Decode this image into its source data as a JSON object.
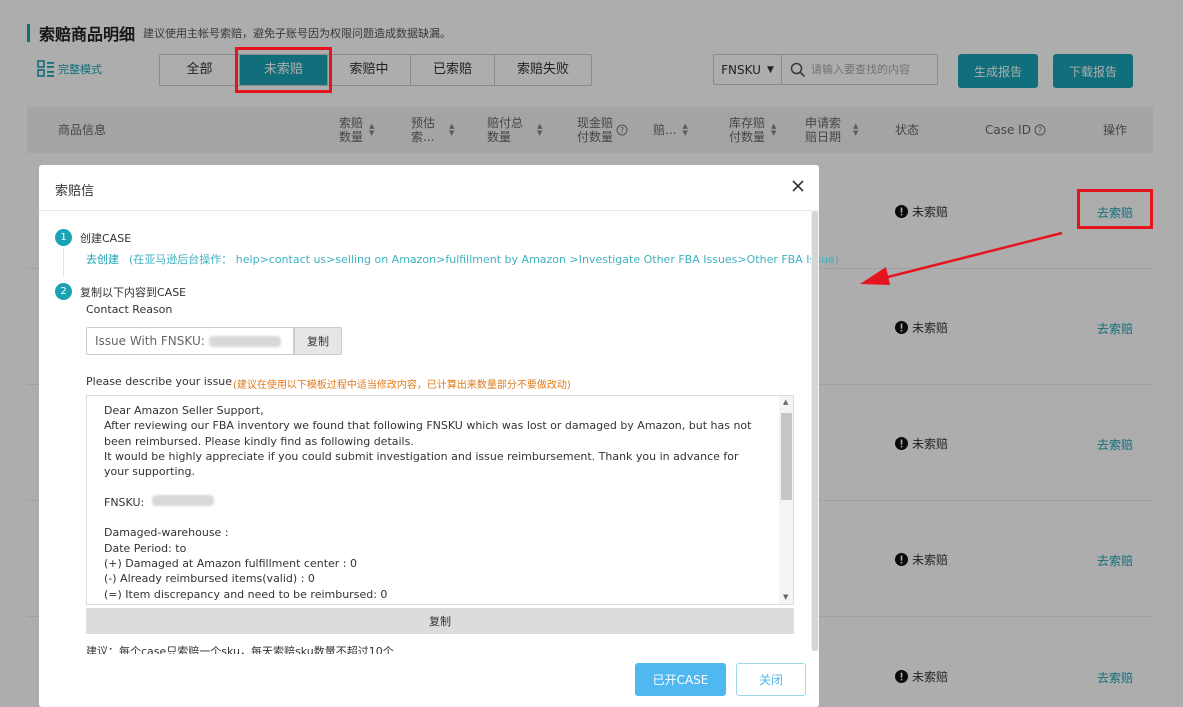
{
  "header": {
    "title": "索赔商品明细",
    "note": "建议使用主帐号索赔，避免子账号因为权限问题造成数据缺漏。",
    "full_mode": "完整模式"
  },
  "tabs": [
    {
      "label": "全部",
      "active": false
    },
    {
      "label": "未索赔",
      "active": true
    },
    {
      "label": "索赔中",
      "active": false
    },
    {
      "label": "已索赔",
      "active": false
    },
    {
      "label": "索赔失败",
      "active": false
    }
  ],
  "search": {
    "field": "FNSKU",
    "placeholder": "请输入要查找的内容"
  },
  "buttons": {
    "generate": "生成报告",
    "download": "下载报告"
  },
  "table": {
    "columns": {
      "product": "商品信息",
      "claim_qty_1": "索赔",
      "claim_qty_2": "数量",
      "est_1": "预估",
      "est_2": "索...",
      "paid_1": "赔付总",
      "paid_2": "数量",
      "cash_1": "现金赔",
      "cash_2": "付数量",
      "pay": "赔...",
      "stock_1": "库存赔",
      "stock_2": "付数量",
      "date_1": "申请索",
      "date_2": "赔日期",
      "status": "状态",
      "case_id": "Case ID",
      "action": "操作"
    },
    "rows": [
      {
        "status": "未索赔",
        "action": "去索赔"
      },
      {
        "status": "未索赔",
        "action": "去索赔"
      },
      {
        "status": "未索赔",
        "action": "去索赔"
      },
      {
        "status": "未索赔",
        "action": "去索赔"
      },
      {
        "status": "未索赔",
        "action": "去索赔"
      }
    ]
  },
  "modal": {
    "title": "索赔信",
    "step1": {
      "num": "1",
      "label": "创建CASE"
    },
    "create_link": "去创建",
    "create_note": "(在亚马逊后台操作： help>contact us>selling on Amazon>fulfillment by Amazon >Investigate Other FBA Issues>Other FBA Issue)",
    "step2": {
      "num": "2",
      "label": "复制以下内容到CASE"
    },
    "contact_reason": "Contact Reason",
    "issue_label": "Issue With FNSKU:",
    "copy_small": "复制",
    "describe_label": "Please describe your issue",
    "describe_note": "(建议在使用以下模板过程中适当修改内容，已计算出来数量部分不要做改动)",
    "letter": {
      "greeting": "Dear Amazon Seller Support,",
      "body1": "After reviewing our FBA inventory we found that following FNSKU which was lost or damaged by Amazon, but has not been reimbursed. Please kindly find as following details.",
      "body2": "It would be highly appreciate if you could submit investigation and issue reimbursement. Thank you in advance for your supporting.",
      "fnsku_label": "FNSKU:",
      "damaged_title": "Damaged-warehouse :",
      "date_period": "Date Period: to",
      "line_damaged": "(+) Damaged at Amazon fulfillment center : 0",
      "line_reimbursed": "(-) Already reimbursed items(valid) : 0",
      "line_discrepancy": "(=) Item discrepancy and need to be reimbursed: 0"
    },
    "copy_big": "复制",
    "advice": "建议：每个case只索赔一个sku，每天索赔sku数量不超过10个",
    "btn_opened": "已开CASE",
    "btn_close": "关闭"
  },
  "colors": {
    "accent": "#1aa3b5",
    "highlight": "#e6141c",
    "primary_button": "#4fb8f0",
    "note_orange": "#e07b19"
  }
}
